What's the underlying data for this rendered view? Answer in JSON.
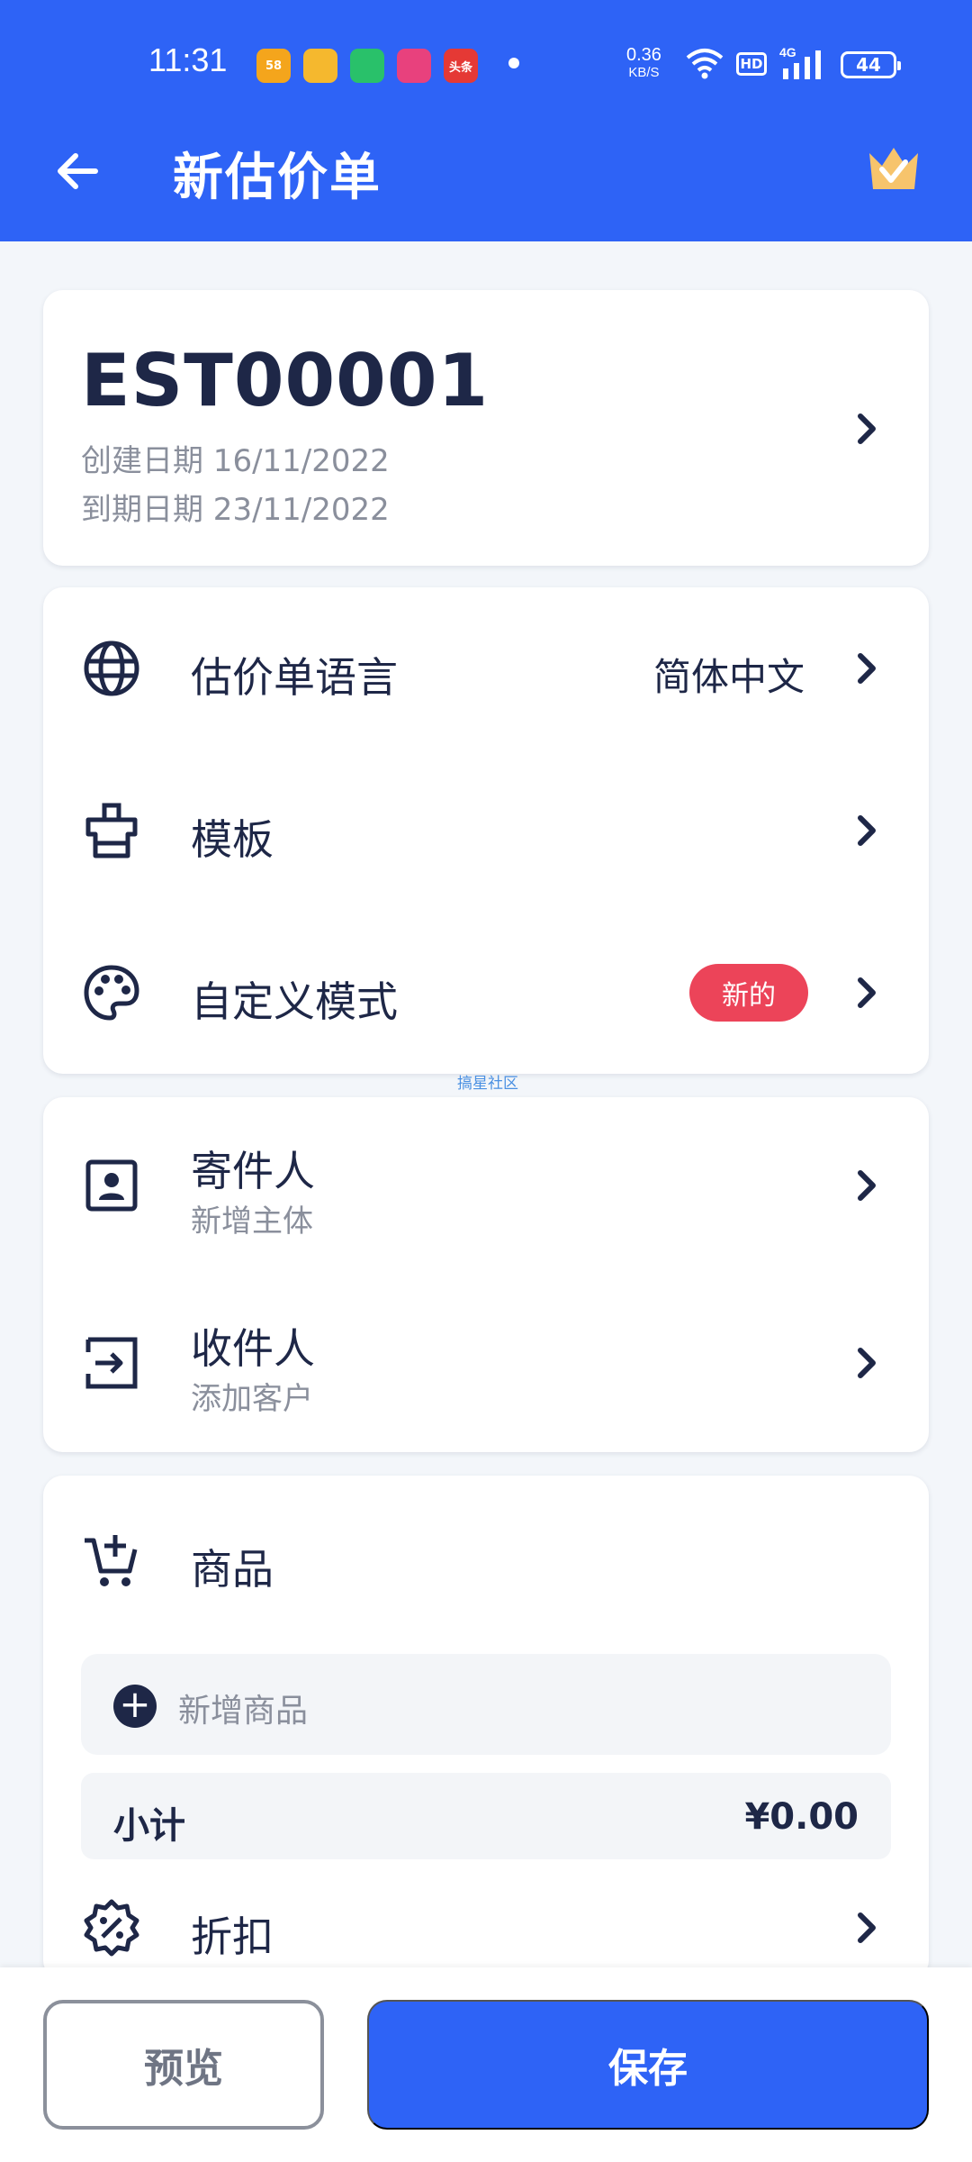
{
  "status_bar": {
    "time": "11:31",
    "app_icons": [
      {
        "name": "58-app-icon",
        "text": "58",
        "color": "#f4a51c"
      },
      {
        "name": "mascot-app-icon",
        "text": "",
        "color": "#f5b82e"
      },
      {
        "name": "chat-app-icon",
        "text": "",
        "color": "#29c16a"
      },
      {
        "name": "video-app-icon",
        "text": "",
        "color": "#e8417d"
      },
      {
        "name": "toutiao-app-icon",
        "text": "头条",
        "color": "#e53935"
      }
    ],
    "net_speed_value": "0.36",
    "net_speed_unit": "KB/S",
    "hd_label": "HD",
    "network_label": "4G",
    "battery": "44"
  },
  "header": {
    "title": "新估价单"
  },
  "estimate": {
    "number": "EST00001",
    "created": "创建日期 16/11/2022",
    "due": "到期日期 23/11/2022"
  },
  "settings": {
    "language_label": "估价单语言",
    "language_value": "简体中文",
    "template_label": "模板",
    "custom_label": "自定义模式",
    "custom_badge": "新的"
  },
  "watermark": "搞星社区",
  "parties": {
    "sender_label": "寄件人",
    "sender_sub": "新增主体",
    "recipient_label": "收件人",
    "recipient_sub": "添加客户"
  },
  "items": {
    "title": "商品",
    "add_label": "新增商品",
    "subtotal_label": "小计",
    "subtotal_value": "¥0.00",
    "discount_label": "折扣"
  },
  "bottom": {
    "preview_label": "预览",
    "save_label": "保存"
  },
  "colors": {
    "primary": "#2e63f6",
    "badge": "#ec4459",
    "text": "#1e2747"
  }
}
